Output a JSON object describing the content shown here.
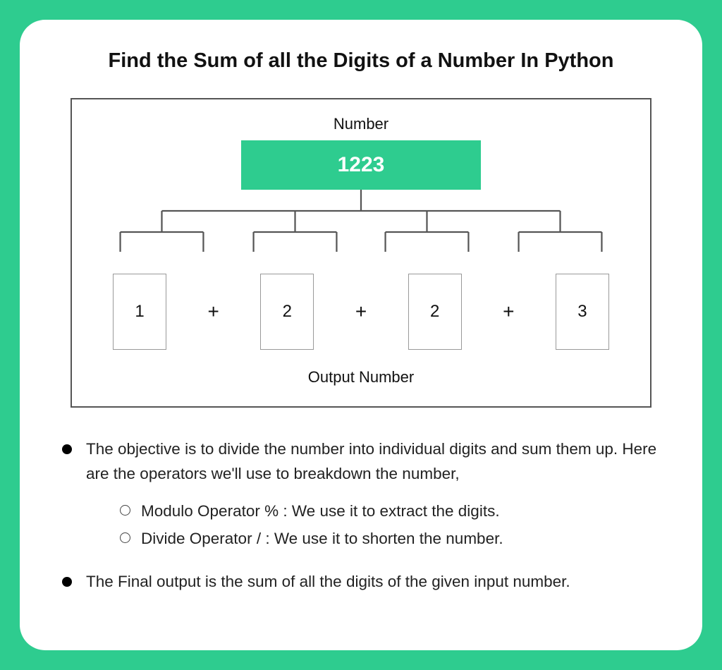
{
  "title": "Find the Sum of all the Digits of a Number In Python",
  "diagram": {
    "top_label": "Number",
    "number_value": "1223",
    "digits": [
      "1",
      "2",
      "2",
      "3"
    ],
    "operator": "+",
    "bottom_label": "Output Number"
  },
  "bullets": {
    "item1": "The objective is to divide the number into individual digits and sum them up. Here are the operators we'll use to breakdown the number,",
    "sub1": "Modulo Operator % : We use it to extract the digits.",
    "sub2": "Divide Operator / : We use it to shorten the number.",
    "item2": "The Final output is the sum of all the digits of the given input number."
  },
  "colors": {
    "accent": "#2ecc8f"
  }
}
